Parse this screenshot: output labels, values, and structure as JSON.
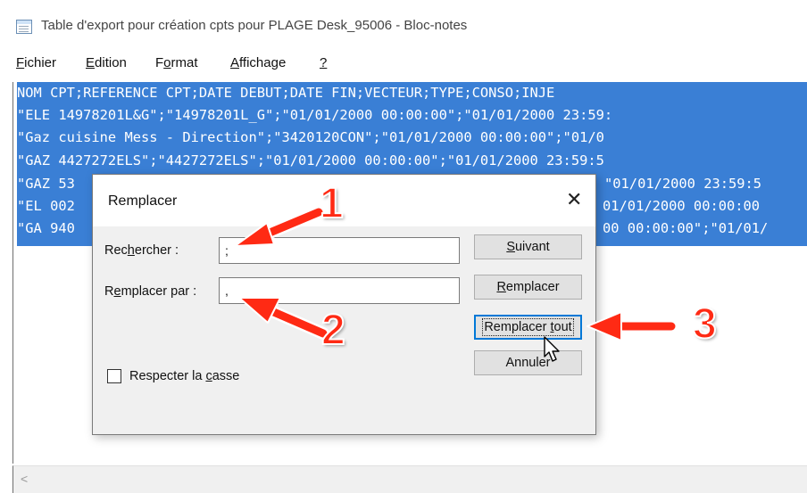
{
  "window": {
    "title": "Table d'export pour création cpts pour PLAGE Desk_95006 - Bloc-notes",
    "icon": "notepad-icon"
  },
  "menu": [
    {
      "pre": "",
      "acc": "F",
      "post": "ichier"
    },
    {
      "pre": "",
      "acc": "E",
      "post": "dition"
    },
    {
      "pre": "F",
      "acc": "o",
      "post": "rmat"
    },
    {
      "pre": "",
      "acc": "A",
      "post": "ffichage"
    },
    {
      "pre": "",
      "acc": "?",
      "post": ""
    }
  ],
  "editor": {
    "selection_color": "#3a7fd5",
    "lines": [
      "NOM CPT;REFERENCE CPT;DATE DEBUT;DATE FIN;VECTEUR;TYPE;CONSO;INJE",
      "\"ELE 14978201L&G\";\"14978201L_G\";\"01/01/2000 00:00:00\";\"01/01/2000 23:59:",
      "\"Gaz cuisine Mess - Direction\";\"3420120CON\";\"01/01/2000 00:00:00\";\"01/0",
      "\"GAZ 4427272ELS\";\"4427272ELS\";\"01/01/2000 00:00:00\";\"01/01/2000 23:59:5",
      "\"GAZ 53",
      "\"EL 002",
      "\"GA 940"
    ],
    "right_fragments": [
      "\"01/01/2000 23:59:5",
      "01/01/2000 00:00:00",
      "00 00:00:00\";\"01/01/"
    ]
  },
  "scrollbar": {
    "left_arrow": "<"
  },
  "dialog": {
    "title": "Remplacer",
    "close_icon": "close-icon",
    "find_label": {
      "pre": "Rec",
      "acc": "h",
      "post": "ercher :"
    },
    "find_value": ";",
    "replace_label": {
      "pre": "R",
      "acc": "e",
      "post": "mplacer par :"
    },
    "replace_value": ",",
    "match_case": {
      "pre": "Respecter la ",
      "acc": "c",
      "post": "asse",
      "checked": false
    },
    "buttons": {
      "next": {
        "pre": "",
        "acc": "S",
        "post": "uivant"
      },
      "replace": {
        "pre": "",
        "acc": "R",
        "post": "emplacer"
      },
      "replace_all": {
        "pre": "Remplacer ",
        "acc": "t",
        "post": "out"
      },
      "cancel": {
        "pre": "Annuler",
        "acc": "",
        "post": ""
      }
    }
  },
  "annotations": {
    "numbers": [
      "1",
      "2",
      "3"
    ],
    "color": "#ff2a14"
  }
}
